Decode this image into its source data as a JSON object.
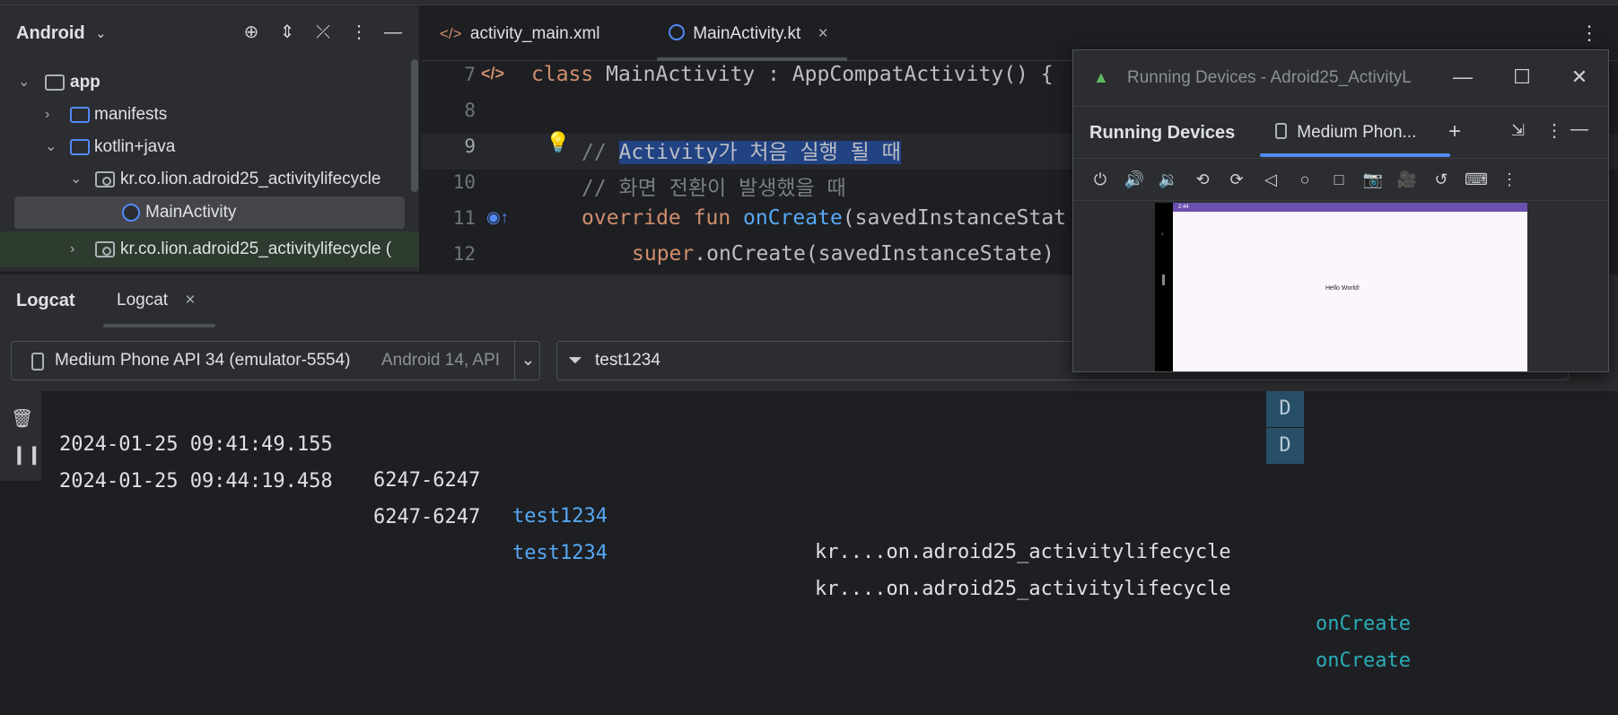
{
  "project_panel": {
    "title": "Android",
    "tree": [
      {
        "label": "app",
        "expanded": true
      },
      {
        "label": "manifests",
        "expanded": false
      },
      {
        "label": "kotlin+java",
        "expanded": true
      },
      {
        "label": "kr.co.lion.adroid25_activitylifecycle",
        "expanded": true
      },
      {
        "label": "MainActivity",
        "selected": true
      },
      {
        "label": "kr.co.lion.adroid25_activitylifecycle (",
        "expanded": false
      }
    ]
  },
  "editor": {
    "tabs": [
      {
        "label": "activity_main.xml",
        "active": false
      },
      {
        "label": "MainActivity.kt",
        "active": true
      }
    ],
    "line_numbers": [
      "7",
      "8",
      "9",
      "10",
      "11",
      "12"
    ],
    "code": {
      "l7_kw": "class ",
      "l7_rest": "MainActivity : AppCompatActivity() {",
      "l9_prefix": "// ",
      "l9_selected": "Activity가 처음 실행 될 때",
      "l10": "// 화면 전환이 발생했을 때",
      "l11_kw": "override fun ",
      "l11_fn": "onCreate",
      "l11_rest": "(savedInstanceStat",
      "l12_kw": "super",
      "l12_rest": ".onCreate(savedInstanceState)"
    }
  },
  "logcat": {
    "title": "Logcat",
    "tab": "Logcat",
    "device_name": "Medium Phone API 34 (emulator-5554)",
    "device_meta": "Android 14, API",
    "filter": "test1234",
    "rows": [
      {
        "time": "2024-01-25 09:41:49.155",
        "pid": "6247-6247",
        "tag": "test1234",
        "pkg": "kr....on.adroid25_activitylifecycle",
        "level": "D",
        "msg": "onCreate"
      },
      {
        "time": "2024-01-25 09:44:19.458",
        "pid": "6247-6247",
        "tag": "test1234",
        "pkg": "kr....on.adroid25_activitylifecycle",
        "level": "D",
        "msg": "onCreate"
      }
    ]
  },
  "running_devices": {
    "window_title": "Running Devices - Adroid25_ActivityL",
    "header_title": "Running Devices",
    "device_tab": "Medium Phon...",
    "phone_status_time": "2:44",
    "phone_text": "Hello World!"
  },
  "colors": {
    "accent": "#548af7",
    "selection": "#214283",
    "log_level_bg": "#275068",
    "status_bar": "#6b50b0"
  }
}
